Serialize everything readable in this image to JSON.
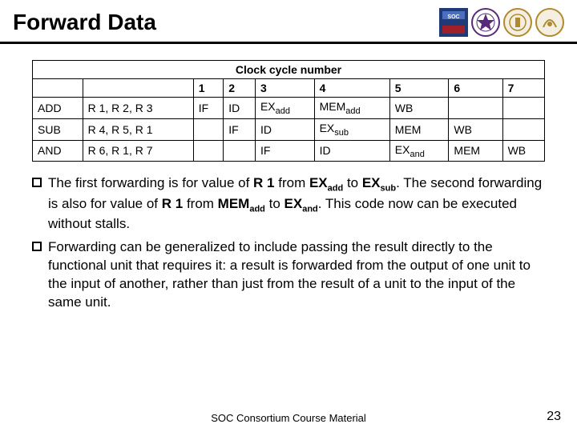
{
  "title": "Forward Data",
  "chart_data": {
    "type": "table",
    "title": "Clock cycle number",
    "columns": [
      "",
      "",
      "1",
      "2",
      "3",
      "4",
      "5",
      "6",
      "7"
    ],
    "rows": [
      {
        "instr": "ADD",
        "regs": "R 1, R 2, R 3",
        "cells": [
          "IF",
          "ID",
          {
            "base": "EX",
            "sub": "add"
          },
          {
            "base": "MEM",
            "sub": "add"
          },
          "WB",
          "",
          ""
        ]
      },
      {
        "instr": "SUB",
        "regs": "R 4, R 5, R 1",
        "cells": [
          "",
          "IF",
          "ID",
          {
            "base": "EX",
            "sub": "sub"
          },
          "MEM",
          "WB",
          ""
        ]
      },
      {
        "instr": "AND",
        "regs": "R 6, R 1, R 7",
        "cells": [
          "",
          "",
          "IF",
          "ID",
          {
            "base": "EX",
            "sub": "and"
          },
          "MEM",
          "WB"
        ]
      }
    ]
  },
  "bullets": [
    {
      "spans": [
        {
          "t": "The first forwarding is for value of "
        },
        {
          "t": "R 1",
          "b": true
        },
        {
          "t": " from "
        },
        {
          "t": "EX",
          "b": true
        },
        {
          "t": "add",
          "b": true,
          "sub": true
        },
        {
          "t": " to "
        },
        {
          "t": "EX",
          "b": true
        },
        {
          "t": "sub",
          "b": true,
          "sub": true
        },
        {
          "t": ". The second forwarding is also for value of "
        },
        {
          "t": "R 1",
          "b": true
        },
        {
          "t": " from "
        },
        {
          "t": "MEM",
          "b": true
        },
        {
          "t": "add",
          "b": true,
          "sub": true
        },
        {
          "t": " to "
        },
        {
          "t": "EX",
          "b": true
        },
        {
          "t": "and",
          "b": true,
          "sub": true
        },
        {
          "t": ". This code now can be executed without stalls."
        }
      ]
    },
    {
      "spans": [
        {
          "t": "Forwarding can be generalized to include passing the result directly to the functional unit that requires it: a result is forwarded from the output of one unit to the input of another, rather than just from the result of a unit to the input of the same unit."
        }
      ]
    }
  ],
  "footer": "SOC Consortium Course Material",
  "page_number": "23",
  "logos": [
    "soc-logo",
    "purple-seal",
    "gold-seal-1",
    "gold-seal-2"
  ]
}
